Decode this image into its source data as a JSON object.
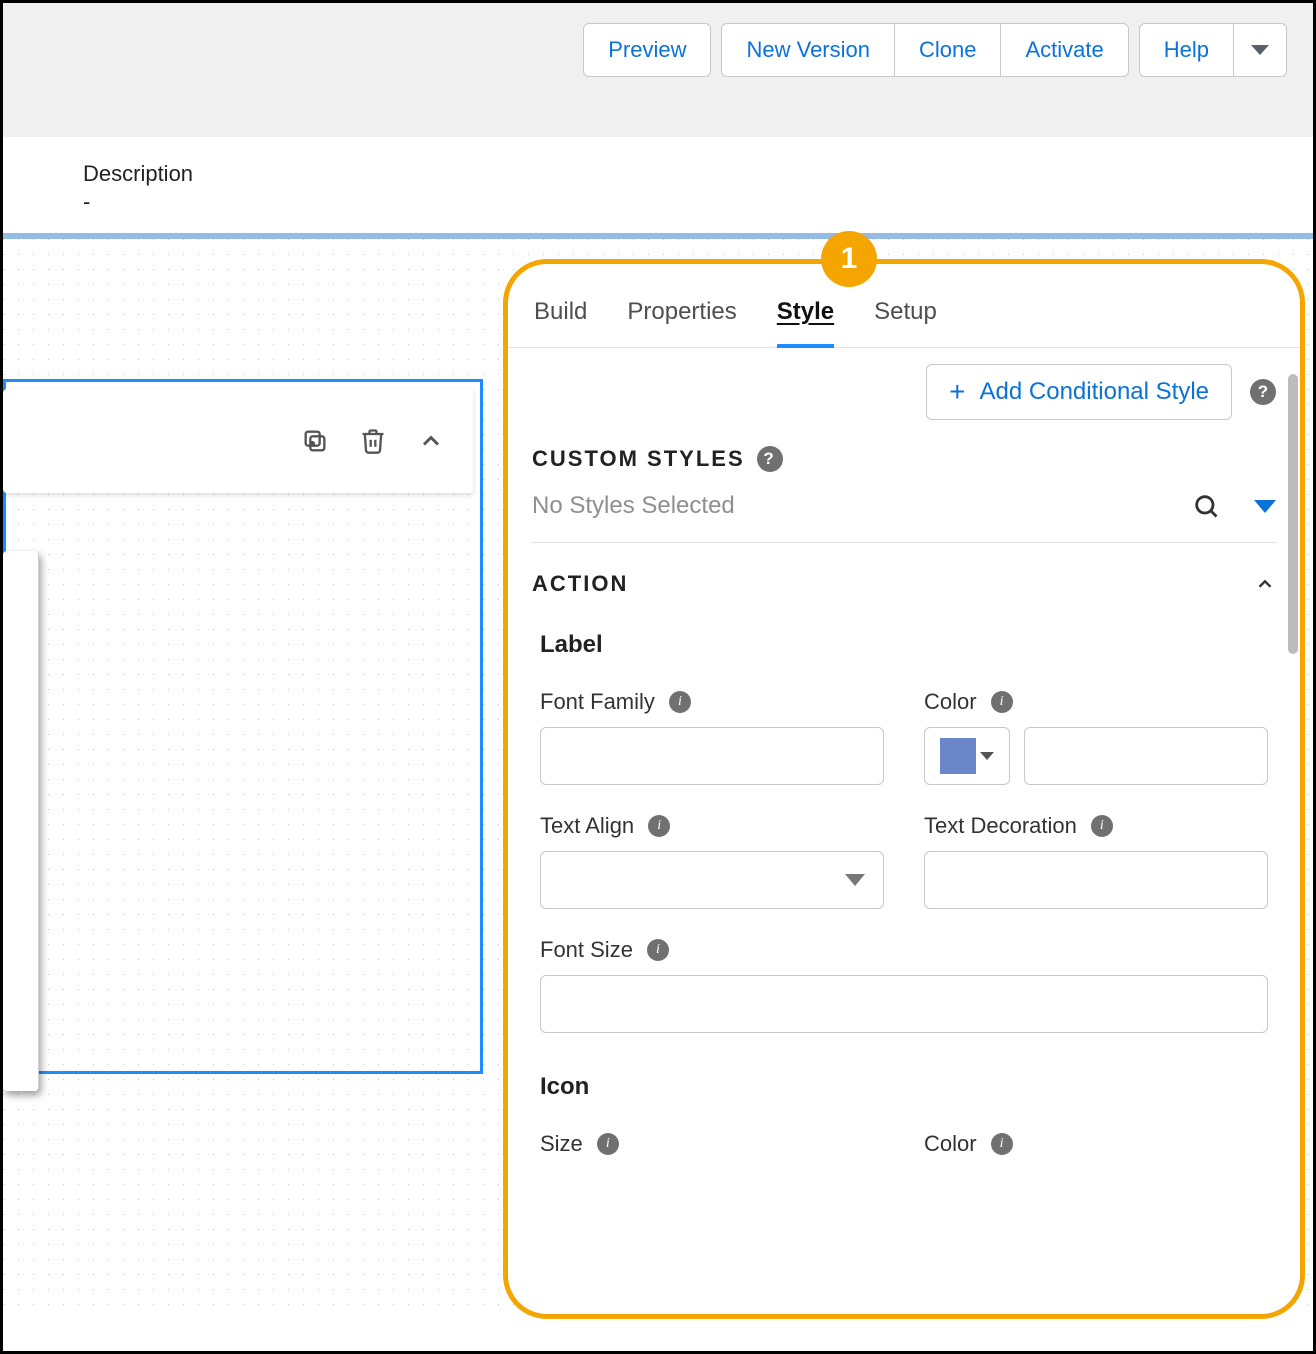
{
  "toolbar": {
    "preview": "Preview",
    "new_version": "New Version",
    "clone": "Clone",
    "activate": "Activate",
    "help": "Help"
  },
  "description": {
    "label": "Description",
    "value": "-"
  },
  "callout": {
    "number": "1"
  },
  "panel": {
    "tabs": {
      "build": "Build",
      "properties": "Properties",
      "style": "Style",
      "setup": "Setup"
    },
    "add_conditional": "Add Conditional Style",
    "custom_styles": {
      "title": "CUSTOM STYLES",
      "placeholder": "No Styles Selected"
    },
    "action": {
      "title": "ACTION",
      "label_group": "Label",
      "icon_group": "Icon",
      "fields": {
        "font_family": "Font Family",
        "color": "Color",
        "text_align": "Text Align",
        "text_decoration": "Text Decoration",
        "font_size": "Font Size",
        "size": "Size"
      }
    }
  },
  "colors": {
    "swatch": "#6a85c8"
  }
}
